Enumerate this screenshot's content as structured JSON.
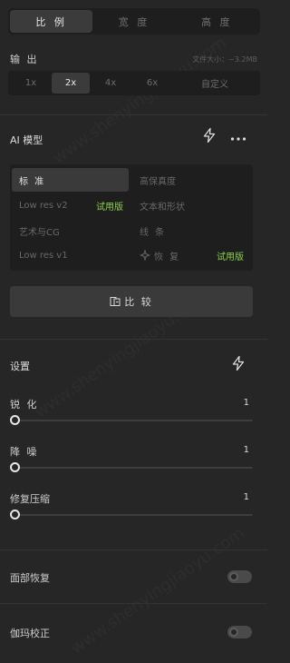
{
  "top_tabs": [
    "比 例",
    "宽 度",
    "高 度"
  ],
  "output": {
    "label": "输 出",
    "file_size": "文件大小：~3.2MB",
    "scales": [
      "1x",
      "2x",
      "4x",
      "6x",
      "自定义"
    ]
  },
  "ai_model": {
    "title": "AI 模型",
    "models": {
      "standard": "标 准",
      "hifi": "高保真度",
      "low_res_v2": "Low res v2",
      "low_res_v2_tag": "试用版",
      "text_shape": "文本和形状",
      "art_cg": "艺术与CG",
      "lines": "线 条",
      "low_res_v1": "Low res v1",
      "restore": "恢 复",
      "restore_tag": "试用版"
    },
    "compare_label": "比 较"
  },
  "settings": {
    "title": "设置",
    "sliders": [
      {
        "label": "锐 化",
        "value": "1"
      },
      {
        "label": "降 噪",
        "value": "1"
      },
      {
        "label": "修复压缩",
        "value": "1"
      }
    ]
  },
  "toggles": {
    "face_restore": "面部恢复",
    "gamma": "伽玛校正"
  },
  "watermark": "www.shenyingjiaoyu.com"
}
